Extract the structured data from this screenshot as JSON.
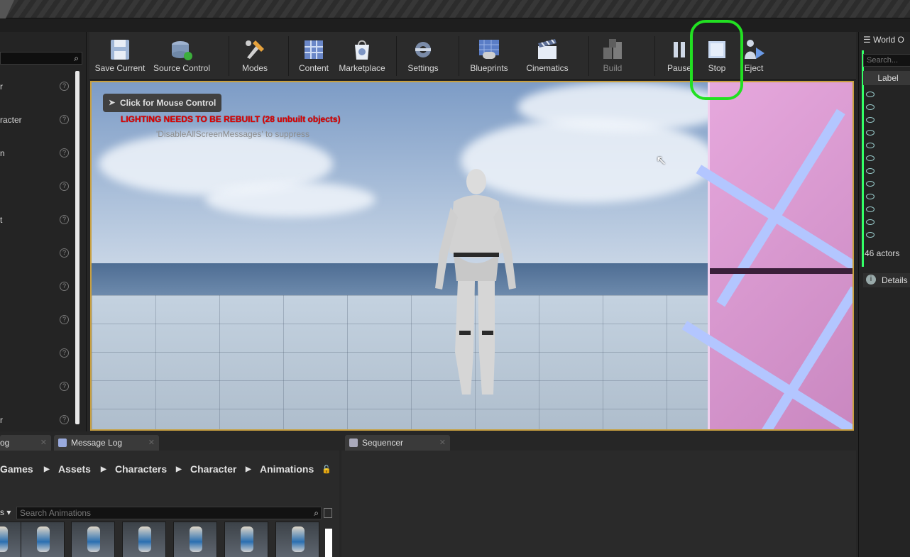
{
  "left_panel": {
    "items": [
      "r",
      "racter",
      "n",
      "",
      "t",
      "",
      "",
      "",
      "",
      "",
      "r"
    ],
    "help_glyph": "?"
  },
  "toolbar": {
    "buttons": [
      {
        "label": "Save Current",
        "icon": "save-icon"
      },
      {
        "label": "Source Control",
        "icon": "source-control-icon"
      },
      {
        "label": "Modes",
        "icon": "modes-icon"
      },
      {
        "label": "Content",
        "icon": "content-icon"
      },
      {
        "label": "Marketplace",
        "icon": "marketplace-icon"
      },
      {
        "label": "Settings",
        "icon": "settings-icon"
      },
      {
        "label": "Blueprints",
        "icon": "blueprints-icon"
      },
      {
        "label": "Cinematics",
        "icon": "cinematics-icon"
      },
      {
        "label": "Build",
        "icon": "build-icon"
      },
      {
        "label": "Pause",
        "icon": "pause-icon"
      },
      {
        "label": "Stop",
        "icon": "stop-icon"
      },
      {
        "label": "Eject",
        "icon": "eject-icon"
      }
    ],
    "highlight_color": "#22e022"
  },
  "viewport": {
    "mouse_control": "Click for Mouse Control",
    "warning": "LIGHTING NEEDS TO BE REBUILT (28 unbuilt objects)",
    "suppress_hint": "'DisableAllScreenMessages' to suppress",
    "border_color": "#c8a040"
  },
  "world_outliner": {
    "title": "World O",
    "search_placeholder": "Search...",
    "column_label": "Label",
    "actor_count": "46 actors",
    "details_tab": "Details"
  },
  "bottom": {
    "tabs": [
      "og",
      "Message Log",
      "Sequencer"
    ],
    "breadcrumbs": [
      "Games",
      "Assets",
      "Characters",
      "Character",
      "Animations"
    ],
    "asset_search_placeholder": "Search Animations",
    "thumbnails_count_label": "",
    "filter_glyph": "s"
  }
}
